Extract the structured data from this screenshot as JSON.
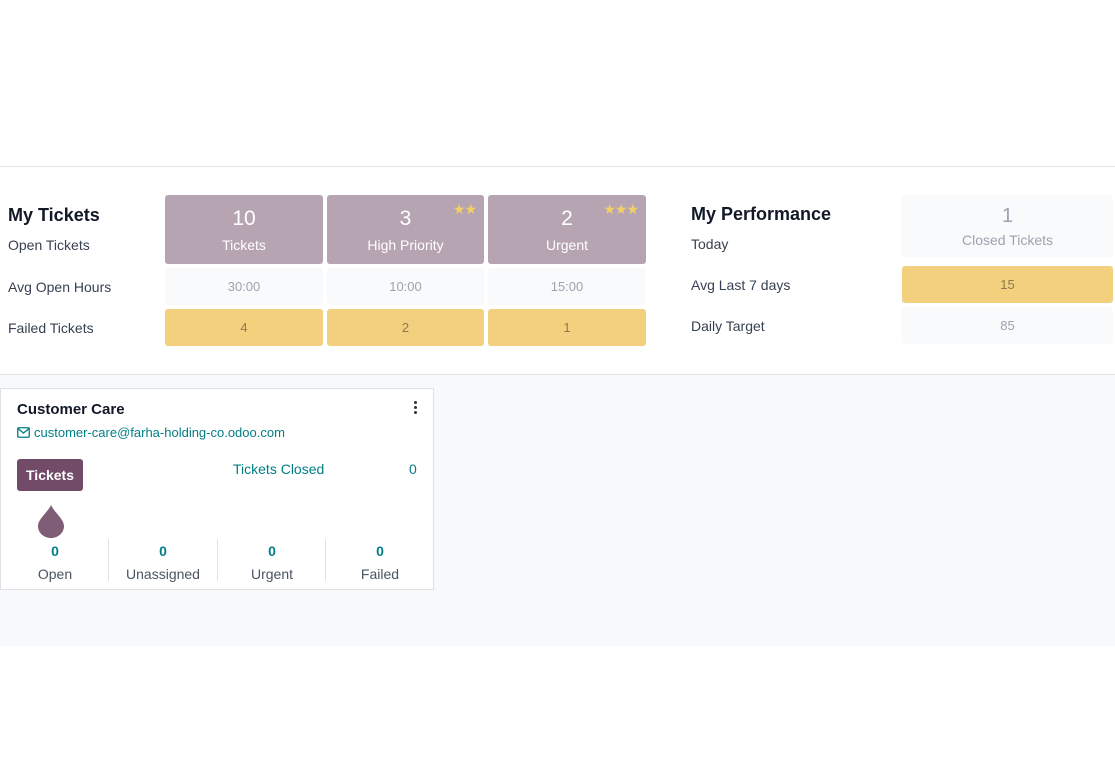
{
  "my_tickets": {
    "title": "My Tickets",
    "row_labels": {
      "open": "Open Tickets",
      "avg_hours": "Avg Open Hours",
      "failed": "Failed Tickets"
    },
    "tiles": [
      {
        "value": "10",
        "caption": "Tickets",
        "stars": ""
      },
      {
        "value": "3",
        "caption": "High Priority",
        "stars": "★★"
      },
      {
        "value": "2",
        "caption": "Urgent",
        "stars": "★★★"
      }
    ],
    "avg_hours": [
      "30:00",
      "10:00",
      "15:00"
    ],
    "failed": [
      "4",
      "2",
      "1"
    ]
  },
  "my_performance": {
    "title": "My Performance",
    "today_label": "Today",
    "today_value": "1",
    "today_caption": "Closed Tickets",
    "avg7_label": "Avg Last 7 days",
    "avg7_value": "15",
    "target_label": "Daily Target",
    "target_value": "85"
  },
  "team_card": {
    "name": "Customer Care",
    "email": "customer-care@farha-holding-co.odoo.com",
    "button_label": "Tickets",
    "closed_label": "Tickets Closed",
    "closed_value": "0",
    "stats": [
      {
        "value": "0",
        "label": "Open"
      },
      {
        "value": "0",
        "label": "Unassigned"
      },
      {
        "value": "0",
        "label": "Urgent"
      },
      {
        "value": "0",
        "label": "Failed"
      }
    ]
  },
  "colors": {
    "tile": "#b7a4b3",
    "warning": "#f2d07e",
    "primary": "#714b67",
    "link": "#017e84"
  }
}
